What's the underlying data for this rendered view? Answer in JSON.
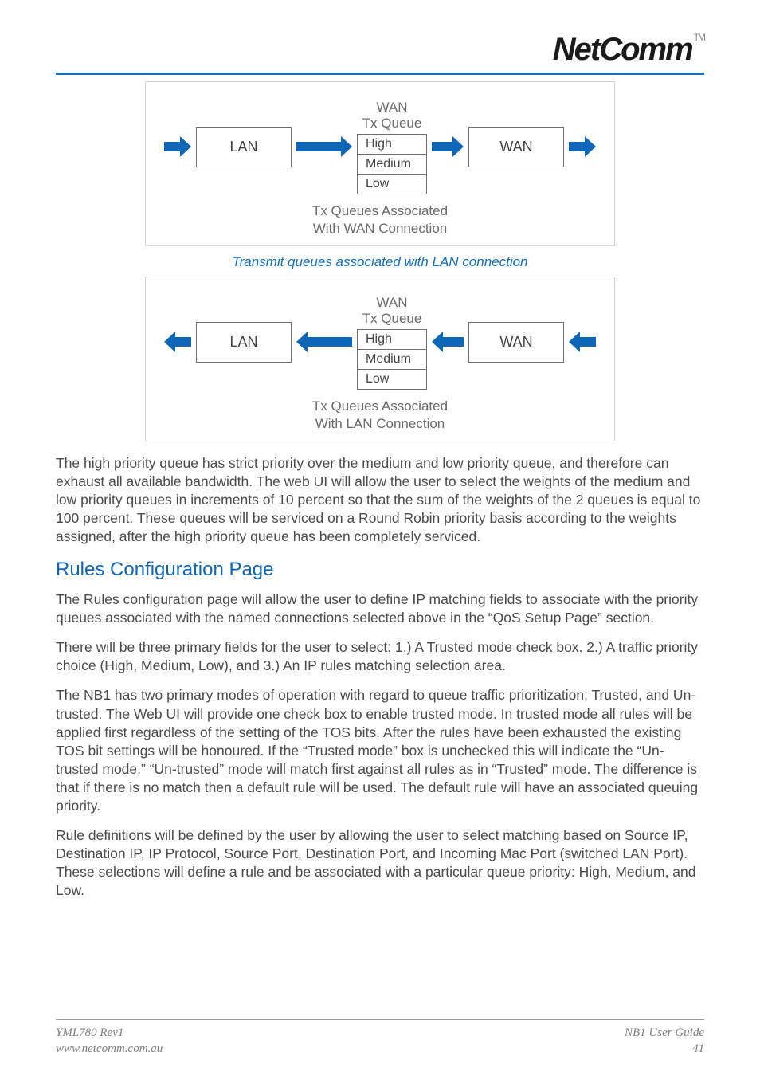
{
  "brand": {
    "name": "NetComm",
    "trademark": "TM"
  },
  "diagram1": {
    "queue_title": "WAN\nTx Queue",
    "levels": [
      "High",
      "Medium",
      "Low"
    ],
    "left_box": "LAN",
    "right_box": "WAN",
    "assoc": "Tx Queues Associated\nWith WAN Connection"
  },
  "caption1": "Transmit queues associated with LAN connection",
  "diagram2": {
    "queue_title": "WAN\nTx Queue",
    "levels": [
      "High",
      "Medium",
      "Low"
    ],
    "left_box": "LAN",
    "right_box": "WAN",
    "assoc": "Tx Queues Associated\nWith LAN Connection"
  },
  "para1": "The high priority queue has strict priority over the medium and low priority queue, and therefore can exhaust all available bandwidth. The web UI will allow the user to select the weights of the medium and low priority queues in increments of 10 percent so that the sum of the weights of the 2 queues is equal to 100 percent. These queues will be serviced on a Round Robin priority basis according to the weights assigned, after the high priority queue has been completely serviced.",
  "heading1": "Rules Configuration Page",
  "para2": "The Rules configuration page will allow the user to define IP matching fields to associate with the priority queues associated with the named connections selected above in the “QoS Setup Page” section.",
  "para3": "There will be three primary fields for the user to select: 1.) A Trusted mode check box. 2.) A traffic priority choice (High, Medium, Low), and 3.) An IP rules matching selection area.",
  "para4": "The NB1 has two primary modes of operation with regard to queue traffic prioritization; Trusted, and Un-trusted. The Web UI will provide one check box to enable trusted mode. In trusted mode all rules will be applied first regardless of the setting of the TOS bits. After the rules have been exhausted the existing TOS bit settings will be honoured. If the “Trusted mode” box is unchecked this will indicate the “Un-trusted mode.” “Un-trusted” mode will match first against all rules as in “Trusted” mode. The difference is that if there is no match then a default rule will be used. The default rule will have an associated queuing priority.",
  "para5": "Rule definitions will be defined by the user by allowing the user to select matching based on Source IP, Destination IP, IP Protocol, Source Port, Destination Port, and Incoming Mac Port (switched LAN Port). These selections will define a rule and be associated with a particular queue priority: High, Medium, and Low.",
  "footer": {
    "left1": "YML780 Rev1",
    "left2": "www.netcomm.com.au",
    "right1": "NB1 User Guide",
    "right2": "41"
  }
}
